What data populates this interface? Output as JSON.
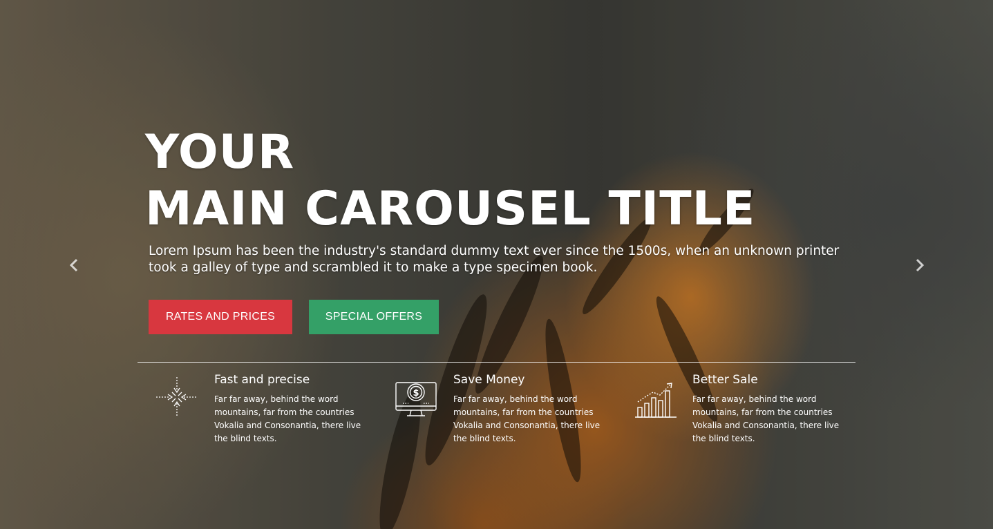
{
  "hero": {
    "title_line1": "YOUR",
    "title_line2": "MAIN CAROUSEL TITLE",
    "lead": "Lorem Ipsum has been the industry's standard dummy text ever since the 1500s, when an unknown printer took a galley of type and scrambled it to make a type specimen book.",
    "background_description_icon": "tiger-photo"
  },
  "buttons": {
    "rates_label": "RATES AND PRICES",
    "offers_label": "SPECIAL OFFERS"
  },
  "colors": {
    "rates_button": "#d8373f",
    "offers_button": "#34a067",
    "text": "#ffffff"
  },
  "carousel": {
    "prev_icon": "chevron-left-icon",
    "next_icon": "chevron-right-icon"
  },
  "features": [
    {
      "icon": "arrows-converge-icon",
      "title": "Fast and precise",
      "text": "Far far away, behind the word mountains, far from the countries Vokalia and Consonantia, there live the blind texts."
    },
    {
      "icon": "monitor-dollar-icon",
      "title": "Save Money",
      "text": "Far far away, behind the word mountains, far from the countries Vokalia and Consonantia, there live the blind texts."
    },
    {
      "icon": "bar-chart-growth-icon",
      "title": "Better Sale",
      "text": "Far far away, behind the word mountains, far from the countries Vokalia and Consonantia, there live the blind texts."
    }
  ]
}
